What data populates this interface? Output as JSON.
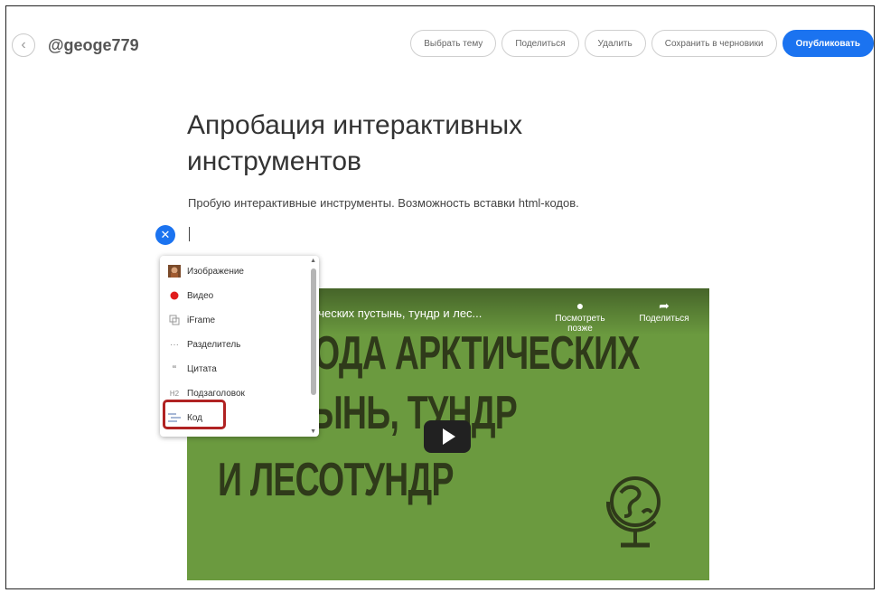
{
  "header": {
    "back_icon": "chevron-left-icon",
    "username": "@geoge779",
    "buttons": {
      "choose_topic": "Выбрать тему",
      "share": "Поделиться",
      "delete": "Удалить",
      "save_draft": "Сохранить в черновики",
      "publish": "Опубликовать"
    }
  },
  "article": {
    "title_line1": "Апробация интерактивных",
    "title_line2": "инструментов",
    "subtitle": "Пробую интерактивные инструменты. Возможность вставки html-кодов."
  },
  "insert_menu": {
    "items": [
      {
        "label": "Изображение",
        "icon": "image-icon"
      },
      {
        "label": "Видео",
        "icon": "video-icon"
      },
      {
        "label": "iFrame",
        "icon": "iframe-icon"
      },
      {
        "label": "Разделитель",
        "icon": "divider-icon"
      },
      {
        "label": "Цитата",
        "icon": "quote-icon"
      },
      {
        "label": "Подзаголовок",
        "icon": "heading-icon"
      },
      {
        "label": "Код",
        "icon": "code-icon"
      }
    ],
    "highlighted_item": "Код"
  },
  "video": {
    "title_fragment": "тических пустынь, тундр и лес...",
    "watch_later": "Посмотреть позже",
    "share": "Поделиться",
    "overlay_line1": "ОДА АРКТИЧЕСКИХ",
    "overlay_line2": "ЫНЬ, ТУНДР",
    "overlay_line3": "И ЛЕСОТУНДР"
  },
  "colors": {
    "accent": "#1b73f0",
    "video_bg": "#6b9a3f",
    "video_text": "#2f3a1a",
    "highlight": "#b02222"
  }
}
